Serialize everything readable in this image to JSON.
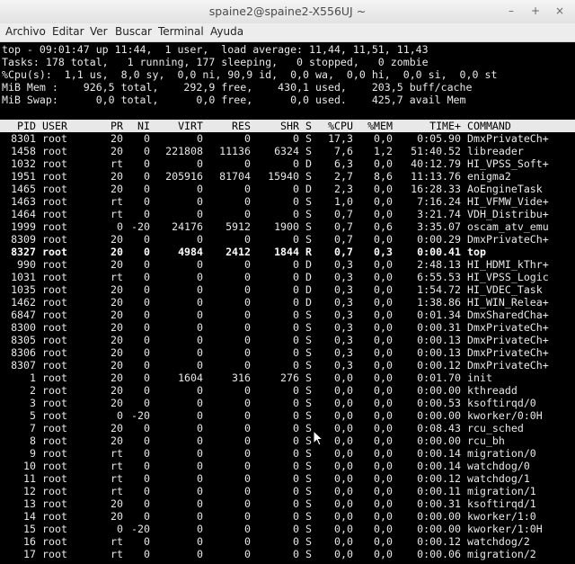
{
  "window": {
    "title": "spaine2@spaine2-X556UJ ~"
  },
  "window_buttons": {
    "minimize": "–",
    "maximize": "+",
    "close": "×"
  },
  "menu": [
    "Archivo",
    "Editar",
    "Ver",
    "Buscar",
    "Terminal",
    "Ayuda"
  ],
  "summary": {
    "line1": "top - 09:01:47 up 11:44,  1 user,  load average: 11,44, 11,51, 11,43",
    "line2": "Tasks: 178 total,   1 running, 177 sleeping,   0 stopped,   0 zombie",
    "line3": "%Cpu(s):  1,1 us,  8,0 sy,  0,0 ni, 90,9 id,  0,0 wa,  0,0 hi,  0,0 si,  0,0 st",
    "line4": "MiB Mem :    926,5 total,    292,9 free,    430,1 used,    203,5 buff/cache",
    "line5": "MiB Swap:      0,0 total,      0,0 free,      0,0 used.    425,7 avail Mem"
  },
  "columns": [
    "PID",
    "USER",
    "PR",
    "NI",
    "VIRT",
    "RES",
    "SHR",
    "S",
    "%CPU",
    "%MEM",
    "TIME+",
    "COMMAND"
  ],
  "processes": [
    [
      "8301",
      "root",
      "20",
      "0",
      "0",
      "0",
      "0",
      "S",
      "17,3",
      "0,0",
      "0:05.90",
      "DmxPrivateCh+"
    ],
    [
      "1458",
      "root",
      "20",
      "0",
      "221808",
      "11136",
      "6324",
      "S",
      "7,6",
      "1,2",
      "51:40.52",
      "libreader"
    ],
    [
      "1032",
      "root",
      "rt",
      "0",
      "0",
      "0",
      "0",
      "D",
      "6,3",
      "0,0",
      "40:12.79",
      "HI_VPSS_Soft+"
    ],
    [
      "1951",
      "root",
      "20",
      "0",
      "205916",
      "81704",
      "15940",
      "S",
      "2,7",
      "8,6",
      "11:13.76",
      "enigma2"
    ],
    [
      "1465",
      "root",
      "20",
      "0",
      "0",
      "0",
      "0",
      "D",
      "2,3",
      "0,0",
      "16:28.33",
      "AoEngineTask"
    ],
    [
      "1463",
      "root",
      "rt",
      "0",
      "0",
      "0",
      "0",
      "S",
      "1,0",
      "0,0",
      "7:16.24",
      "HI_VFMW_Vide+"
    ],
    [
      "1464",
      "root",
      "rt",
      "0",
      "0",
      "0",
      "0",
      "S",
      "0,7",
      "0,0",
      "3:21.74",
      "VDH_Distribu+"
    ],
    [
      "1999",
      "root",
      "0",
      "-20",
      "24176",
      "5912",
      "1900",
      "S",
      "0,7",
      "0,6",
      "3:35.07",
      "oscam_atv_emu"
    ],
    [
      "8309",
      "root",
      "20",
      "0",
      "0",
      "0",
      "0",
      "S",
      "0,7",
      "0,0",
      "0:00.29",
      "DmxPrivateCh+"
    ],
    [
      "8327",
      "root",
      "20",
      "0",
      "4984",
      "2412",
      "1844",
      "R",
      "0,7",
      "0,3",
      "0:00.41",
      "top"
    ],
    [
      "990",
      "root",
      "20",
      "0",
      "0",
      "0",
      "0",
      "D",
      "0,3",
      "0,0",
      "2:48.13",
      "HI_HDMI_kThr+"
    ],
    [
      "1031",
      "root",
      "rt",
      "0",
      "0",
      "0",
      "0",
      "D",
      "0,3",
      "0,0",
      "6:55.53",
      "HI_VPSS_Logic"
    ],
    [
      "1035",
      "root",
      "20",
      "0",
      "0",
      "0",
      "0",
      "D",
      "0,3",
      "0,0",
      "1:54.72",
      "HI_VDEC_Task"
    ],
    [
      "1462",
      "root",
      "20",
      "0",
      "0",
      "0",
      "0",
      "D",
      "0,3",
      "0,0",
      "1:38.86",
      "HI_WIN_Relea+"
    ],
    [
      "6847",
      "root",
      "20",
      "0",
      "0",
      "0",
      "0",
      "S",
      "0,3",
      "0,0",
      "0:01.34",
      "DmxSharedCha+"
    ],
    [
      "8300",
      "root",
      "20",
      "0",
      "0",
      "0",
      "0",
      "S",
      "0,3",
      "0,0",
      "0:00.31",
      "DmxPrivateCh+"
    ],
    [
      "8305",
      "root",
      "20",
      "0",
      "0",
      "0",
      "0",
      "S",
      "0,3",
      "0,0",
      "0:00.13",
      "DmxPrivateCh+"
    ],
    [
      "8306",
      "root",
      "20",
      "0",
      "0",
      "0",
      "0",
      "S",
      "0,3",
      "0,0",
      "0:00.13",
      "DmxPrivateCh+"
    ],
    [
      "8307",
      "root",
      "20",
      "0",
      "0",
      "0",
      "0",
      "S",
      "0,3",
      "0,0",
      "0:00.12",
      "DmxPrivateCh+"
    ],
    [
      "1",
      "root",
      "20",
      "0",
      "1604",
      "316",
      "276",
      "S",
      "0,0",
      "0,0",
      "0:01.70",
      "init"
    ],
    [
      "2",
      "root",
      "20",
      "0",
      "0",
      "0",
      "0",
      "S",
      "0,0",
      "0,0",
      "0:00.00",
      "kthreadd"
    ],
    [
      "3",
      "root",
      "20",
      "0",
      "0",
      "0",
      "0",
      "S",
      "0,0",
      "0,0",
      "0:00.53",
      "ksoftirqd/0"
    ],
    [
      "5",
      "root",
      "0",
      "-20",
      "0",
      "0",
      "0",
      "S",
      "0,0",
      "0,0",
      "0:00.00",
      "kworker/0:0H"
    ],
    [
      "7",
      "root",
      "20",
      "0",
      "0",
      "0",
      "0",
      "S",
      "0,0",
      "0,0",
      "0:08.43",
      "rcu_sched"
    ],
    [
      "8",
      "root",
      "20",
      "0",
      "0",
      "0",
      "0",
      "S",
      "0,0",
      "0,0",
      "0:00.00",
      "rcu_bh"
    ],
    [
      "9",
      "root",
      "rt",
      "0",
      "0",
      "0",
      "0",
      "S",
      "0,0",
      "0,0",
      "0:00.14",
      "migration/0"
    ],
    [
      "10",
      "root",
      "rt",
      "0",
      "0",
      "0",
      "0",
      "S",
      "0,0",
      "0,0",
      "0:00.14",
      "watchdog/0"
    ],
    [
      "11",
      "root",
      "rt",
      "0",
      "0",
      "0",
      "0",
      "S",
      "0,0",
      "0,0",
      "0:00.12",
      "watchdog/1"
    ],
    [
      "12",
      "root",
      "rt",
      "0",
      "0",
      "0",
      "0",
      "S",
      "0,0",
      "0,0",
      "0:00.11",
      "migration/1"
    ],
    [
      "13",
      "root",
      "20",
      "0",
      "0",
      "0",
      "0",
      "S",
      "0,0",
      "0,0",
      "0:00.31",
      "ksoftirqd/1"
    ],
    [
      "14",
      "root",
      "20",
      "0",
      "0",
      "0",
      "0",
      "S",
      "0,0",
      "0,0",
      "0:00.00",
      "kworker/1:0"
    ],
    [
      "15",
      "root",
      "0",
      "-20",
      "0",
      "0",
      "0",
      "S",
      "0,0",
      "0,0",
      "0:00.00",
      "kworker/1:0H"
    ],
    [
      "16",
      "root",
      "rt",
      "0",
      "0",
      "0",
      "0",
      "S",
      "0,0",
      "0,0",
      "0:00.12",
      "watchdog/2"
    ],
    [
      "17",
      "root",
      "rt",
      "0",
      "0",
      "0",
      "0",
      "S",
      "0,0",
      "0,0",
      "0:00.06",
      "migration/2"
    ]
  ],
  "highlight_pid": "8327",
  "colors": {
    "terminal_bg": "#000000",
    "terminal_fg": "#e8e8e8",
    "header_bg": "#e8e8e8"
  }
}
